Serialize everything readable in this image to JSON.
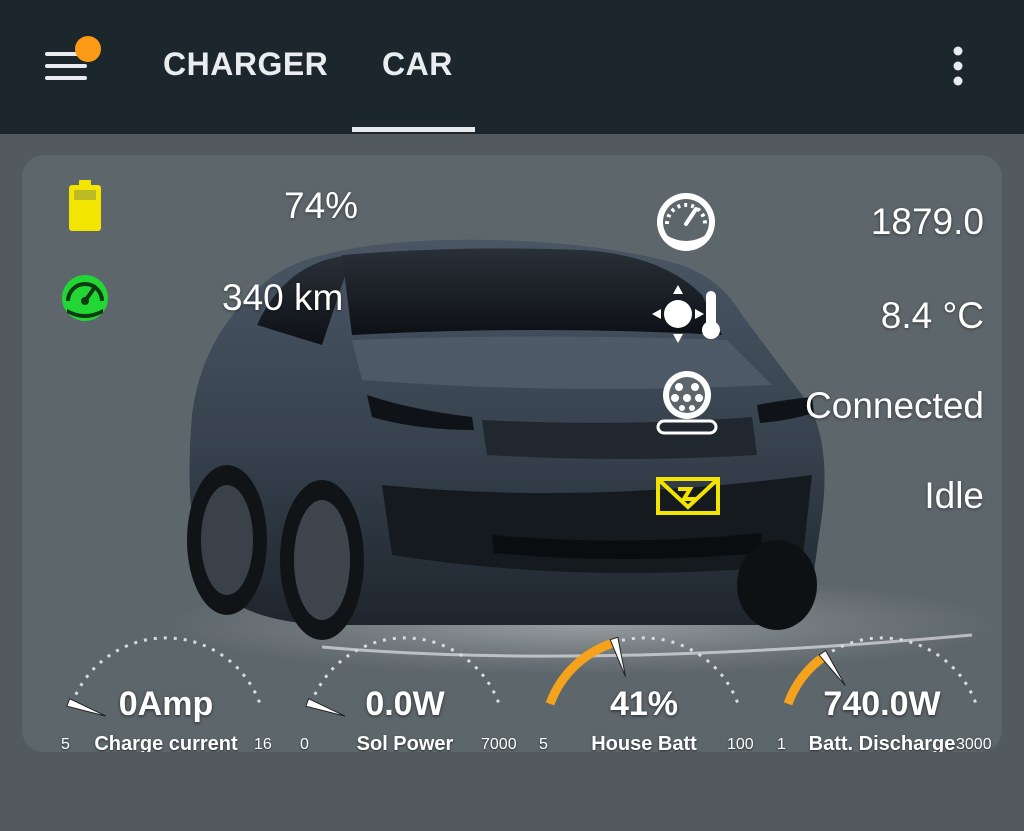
{
  "tabs": [
    {
      "label": "CHARGER",
      "active": false
    },
    {
      "label": "CAR",
      "active": true
    }
  ],
  "status": {
    "battery_percent": "74%",
    "range": "340 km",
    "odometer": "1879.0",
    "temperature": "8.4 °C",
    "plug_status": "Connected",
    "charging_status": "Idle"
  },
  "gauges": [
    {
      "value": "0Amp",
      "label": "Charge current",
      "min": "5",
      "max": "16",
      "fraction": 0.0
    },
    {
      "value": "0.0W",
      "label": "Sol Power",
      "min": "0",
      "max": "7000",
      "fraction": 0.0
    },
    {
      "value": "41%",
      "label": "House Batt",
      "min": "5",
      "max": "100",
      "fraction": 0.38
    },
    {
      "value": "740.0W",
      "label": "Batt. Discharge",
      "min": "1",
      "max": "3000",
      "fraction": 0.25
    }
  ],
  "colors": {
    "topbar": "#1b262d",
    "card": "#5d666b",
    "battery_icon": "#f2e600",
    "range_icon": "#22d633",
    "charging_icon": "#f0e400",
    "gauge_arc": "#f5a21c",
    "notification_dot": "#fa9a15"
  },
  "icons": {
    "menu": "menu-icon",
    "battery": "battery-icon",
    "range": "speedometer-icon",
    "odometer": "odometer-icon",
    "temperature": "temperature-icon",
    "plug": "ev-plug-icon",
    "charging": "charging-status-icon",
    "more": "more-vertical-icon"
  }
}
